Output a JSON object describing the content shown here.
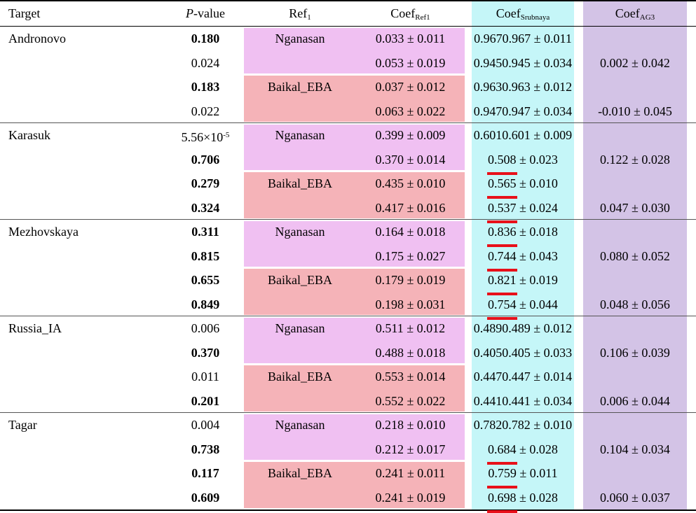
{
  "headers": {
    "target": "Target",
    "p_italic": "P",
    "p_rest": "-value",
    "ref_main": "Ref",
    "ref_sub": "1",
    "coef_ref_main": "Coef",
    "coef_ref_sub": "Ref1",
    "coef_srub_main": "Coef",
    "coef_srub_sub": "Srubnaya",
    "coef_ag3_main": "Coef",
    "coef_ag3_sub": "AG3"
  },
  "colors": {
    "nganasan": "#f0c0f2",
    "baikal": "#f5b3b8",
    "srubnaya": "#c5f6f8",
    "ag3": "#d3c3e6",
    "underline": "#e8101a"
  },
  "groups": [
    {
      "target": "Andronovo",
      "rows": [
        {
          "p": "0.180",
          "bold": true,
          "ref": "Nganasan",
          "coef_ref": "0.033 ± 0.011",
          "srub_v": "0.967",
          "srub_e": " ± 0.011",
          "srub_u": false,
          "ag3": ""
        },
        {
          "p": "0.024",
          "bold": false,
          "ref": "",
          "coef_ref": "0.053 ± 0.019",
          "srub_v": "0.945",
          "srub_e": " ± 0.034",
          "srub_u": false,
          "ag3": "0.002 ± 0.042"
        },
        {
          "p": "0.183",
          "bold": true,
          "ref": "Baikal_EBA",
          "coef_ref": "0.037 ± 0.012",
          "srub_v": "0.963",
          "srub_e": " ± 0.012",
          "srub_u": false,
          "ag3": ""
        },
        {
          "p": "0.022",
          "bold": false,
          "ref": "",
          "coef_ref": "0.063 ± 0.022",
          "srub_v": "0.947",
          "srub_e": " ± 0.034",
          "srub_u": false,
          "ag3": "-0.010 ± 0.045"
        }
      ]
    },
    {
      "target": "Karasuk",
      "rows": [
        {
          "p": "",
          "p_base": "5.56×10",
          "p_exp": "-5",
          "bold": false,
          "ref": "Nganasan",
          "coef_ref": "0.399 ± 0.009",
          "srub_v": "0.601",
          "srub_e": " ± 0.009",
          "srub_u": false,
          "ag3": ""
        },
        {
          "p": "0.706",
          "bold": true,
          "ref": "",
          "coef_ref": "0.370 ± 0.014",
          "srub_v": "0.508",
          "srub_e": " ± 0.023",
          "srub_u": true,
          "ag3": "0.122 ± 0.028"
        },
        {
          "p": "0.279",
          "bold": true,
          "ref": "Baikal_EBA",
          "coef_ref": "0.435 ± 0.010",
          "srub_v": "0.565",
          "srub_e": " ± 0.010",
          "srub_u": true,
          "ag3": ""
        },
        {
          "p": "0.324",
          "bold": true,
          "ref": "",
          "coef_ref": "0.417 ± 0.016",
          "srub_v": "0.537",
          "srub_e": " ± 0.024",
          "srub_u": true,
          "ag3": "0.047 ± 0.030"
        }
      ]
    },
    {
      "target": "Mezhovskaya",
      "rows": [
        {
          "p": "0.311",
          "bold": true,
          "ref": "Nganasan",
          "coef_ref": "0.164 ± 0.018",
          "srub_v": "0.836",
          "srub_e": " ± 0.018",
          "srub_u": true,
          "ag3": ""
        },
        {
          "p": "0.815",
          "bold": true,
          "ref": "",
          "coef_ref": "0.175 ± 0.027",
          "srub_v": "0.744",
          "srub_e": " ± 0.043",
          "srub_u": true,
          "ag3": "0.080 ± 0.052"
        },
        {
          "p": "0.655",
          "bold": true,
          "ref": "Baikal_EBA",
          "coef_ref": "0.179 ± 0.019",
          "srub_v": "0.821",
          "srub_e": " ± 0.019",
          "srub_u": true,
          "ag3": ""
        },
        {
          "p": "0.849",
          "bold": true,
          "ref": "",
          "coef_ref": "0.198 ± 0.031",
          "srub_v": "0.754",
          "srub_e": " ± 0.044",
          "srub_u": true,
          "ag3": "0.048 ± 0.056"
        }
      ]
    },
    {
      "target": "Russia_IA",
      "rows": [
        {
          "p": "0.006",
          "bold": false,
          "ref": "Nganasan",
          "coef_ref": "0.511 ± 0.012",
          "srub_v": "0.489",
          "srub_e": " ± 0.012",
          "srub_u": false,
          "ag3": ""
        },
        {
          "p": "0.370",
          "bold": true,
          "ref": "",
          "coef_ref": "0.488 ± 0.018",
          "srub_v": "0.405",
          "srub_e": " ± 0.033",
          "srub_u": false,
          "ag3": "0.106 ± 0.039"
        },
        {
          "p": "0.011",
          "bold": false,
          "ref": "Baikal_EBA",
          "coef_ref": "0.553 ± 0.014",
          "srub_v": "0.447",
          "srub_e": " ± 0.014",
          "srub_u": false,
          "ag3": ""
        },
        {
          "p": "0.201",
          "bold": true,
          "ref": "",
          "coef_ref": "0.552 ± 0.022",
          "srub_v": "0.441",
          "srub_e": " ± 0.034",
          "srub_u": false,
          "ag3": "0.006 ± 0.044"
        }
      ]
    },
    {
      "target": "Tagar",
      "rows": [
        {
          "p": "0.004",
          "bold": false,
          "ref": "Nganasan",
          "coef_ref": "0.218 ± 0.010",
          "srub_v": "0.782",
          "srub_e": " ± 0.010",
          "srub_u": false,
          "ag3": ""
        },
        {
          "p": "0.738",
          "bold": true,
          "ref": "",
          "coef_ref": "0.212 ± 0.017",
          "srub_v": "0.684",
          "srub_e": " ± 0.028",
          "srub_u": true,
          "ag3": "0.104 ± 0.034"
        },
        {
          "p": "0.117",
          "bold": true,
          "ref": "Baikal_EBA",
          "coef_ref": "0.241 ± 0.011",
          "srub_v": "0.759",
          "srub_e": " ± 0.011",
          "srub_u": true,
          "ag3": ""
        },
        {
          "p": "0.609",
          "bold": true,
          "ref": "",
          "coef_ref": "0.241 ± 0.019",
          "srub_v": "0.698",
          "srub_e": " ± 0.028",
          "srub_u": true,
          "ag3": "0.060 ± 0.037"
        }
      ]
    }
  ]
}
